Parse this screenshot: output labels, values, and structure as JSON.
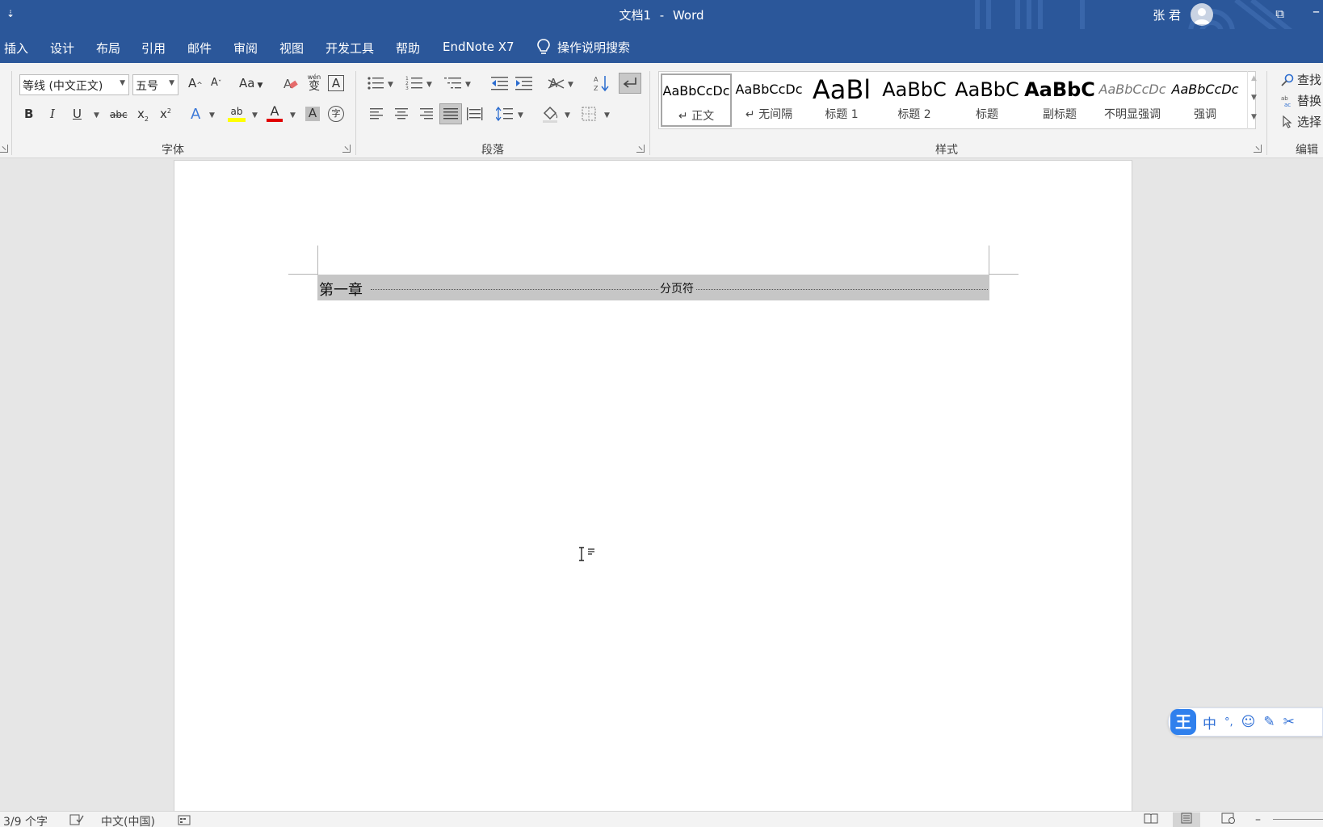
{
  "titlebar": {
    "qat_glyph": "⇣",
    "doc_name": "文档1",
    "separator": "-",
    "app_name": "Word",
    "user_name": "张 君",
    "ribbon_display_glyph": "⧉",
    "minimize_glyph": "–"
  },
  "menu": {
    "tabs": [
      "插入",
      "设计",
      "布局",
      "引用",
      "邮件",
      "审阅",
      "视图",
      "开发工具",
      "帮助",
      "EndNote X7"
    ],
    "tell_me": "操作说明搜索"
  },
  "font_group": {
    "label": "字体",
    "font_name": "等线 (中文正文)",
    "font_size": "五号",
    "grow_glyph": "A",
    "shrink_glyph": "A",
    "case_glyph": "Aa",
    "phonetic_glyph": "wén",
    "phonetic_char": "变",
    "border_glyph": "A",
    "bold": "B",
    "italic": "I",
    "underline": "U",
    "strike": "abc",
    "subscript": "x",
    "subscript_mark": "2",
    "superscript": "x",
    "superscript_mark": "2",
    "effects_glyph": "A",
    "highlight_glyph": "ab",
    "font_color_glyph": "A",
    "shading_glyph": "A",
    "enclose_glyph": "字"
  },
  "paragraph_group": {
    "label": "段落"
  },
  "styles_group": {
    "label": "样式",
    "items": [
      {
        "preview": "AaBbCcDc",
        "name": "正文",
        "mark": "↵"
      },
      {
        "preview": "AaBbCcDc",
        "name": "无间隔",
        "mark": "↵"
      },
      {
        "preview": "AaBl",
        "name": "标题 1",
        "mark": ""
      },
      {
        "preview": "AaBbC",
        "name": "标题 2",
        "mark": ""
      },
      {
        "preview": "AaBbC",
        "name": "标题",
        "mark": ""
      },
      {
        "preview": "AaBbC",
        "name": "副标题",
        "mark": ""
      },
      {
        "preview": "AaBbCcDc",
        "name": "不明显强调",
        "mark": ""
      },
      {
        "preview": "AaBbCcDc",
        "name": "强调",
        "mark": ""
      }
    ]
  },
  "editing_group": {
    "label": "编辑",
    "find": "查找",
    "replace": "替换",
    "select": "选择"
  },
  "document": {
    "heading": "第一章",
    "page_break_label": "分页符"
  },
  "ime": {
    "logo": "王",
    "lang": "中",
    "punct": "°,",
    "emoji": "☺",
    "pen": "✎",
    "scissors": "✂"
  },
  "status": {
    "word_count": "3/9 个字",
    "language": "中文(中国)"
  },
  "colors": {
    "accent": "#2b579a",
    "highlight": "#ffff00",
    "font_color": "#e00000",
    "ime_blue": "#2f80ed"
  }
}
